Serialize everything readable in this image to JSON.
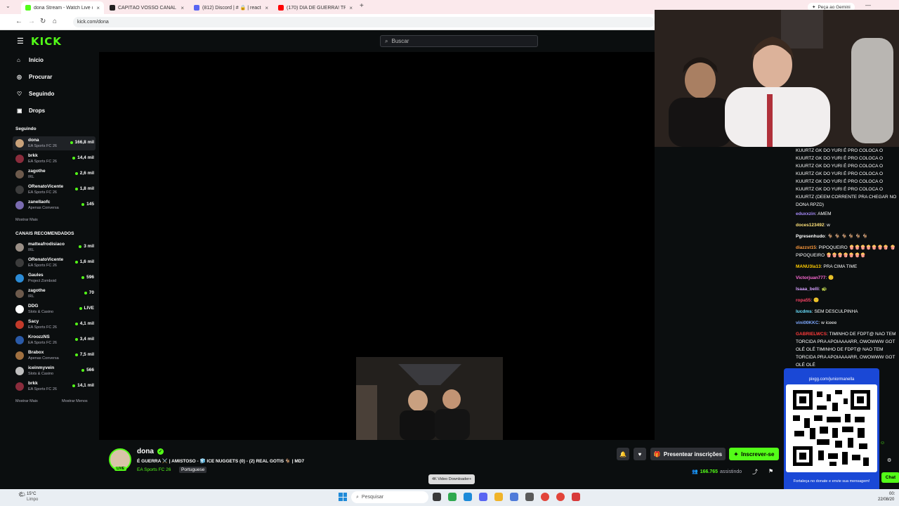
{
  "browser": {
    "tabs": [
      {
        "title": "dona Stream - Watch Live o",
        "color": "#53fc18",
        "active": true
      },
      {
        "title": "CAPITÃO VOSSO CANAL",
        "color": "#222222",
        "active": false
      },
      {
        "title": "(812) Discord | # 🔒 | react-linic",
        "color": "#5865f2",
        "active": false
      },
      {
        "title": "(170) DIA DE GUERRA! TRAR&",
        "color": "#ff0000",
        "active": false
      }
    ],
    "url": "kick.com/dona",
    "gemini": "Peça ao Gemini"
  },
  "header": {
    "logo": "KICK",
    "search_placeholder": "Buscar"
  },
  "sidebar": {
    "nav": [
      {
        "label": "Início",
        "icon": "home-icon"
      },
      {
        "label": "Procurar",
        "icon": "compass-icon"
      },
      {
        "label": "Seguindo",
        "icon": "heart-icon"
      },
      {
        "label": "Drops",
        "icon": "gift-icon"
      }
    ],
    "following_title": "Seguindo",
    "following": [
      {
        "name": "dona",
        "category": "EA Sports FC 26",
        "viewers": "166,8 mil",
        "color": "#c9a27a"
      },
      {
        "name": "brkk",
        "category": "EA Sports FC 26",
        "viewers": "14,4 mil",
        "color": "#8a2c3c"
      },
      {
        "name": "zagothe",
        "category": "IRL",
        "viewers": "2,6 mil",
        "color": "#6d5a4c"
      },
      {
        "name": "ORenatoVicente",
        "category": "EA Sports FC 26",
        "viewers": "1,8 mil",
        "color": "#3c3c3c"
      },
      {
        "name": "zanellaofc",
        "category": "Apenas Conversa",
        "viewers": "145",
        "color": "#7a6bb0"
      }
    ],
    "show_more": "Mostrar Mais",
    "recommended_title": "CANAIS RECOMENDADOS",
    "recommended": [
      {
        "name": "matteafrodisiaco",
        "category": "IRL",
        "viewers": "3 mil",
        "color": "#9a8f86"
      },
      {
        "name": "ORenatoVicente",
        "category": "EA Sports FC 26",
        "viewers": "1,6 mil",
        "color": "#3c3c3c"
      },
      {
        "name": "Gaules",
        "category": "Project Zomboid",
        "viewers": "596",
        "color": "#2b8bd6"
      },
      {
        "name": "zagothe",
        "category": "IRL",
        "viewers": "70",
        "color": "#6d5a4c"
      },
      {
        "name": "DDG",
        "category": "Slots & Casino",
        "viewers": "LIVE",
        "color": "#ffffff"
      },
      {
        "name": "Sacy",
        "category": "EA Sports FC 26",
        "viewers": "4,1 mil",
        "color": "#c23a2a"
      },
      {
        "name": "KroozzNS",
        "category": "EA Sports FC 26",
        "viewers": "3,4 mil",
        "color": "#2a5aa8"
      },
      {
        "name": "Brabox",
        "category": "Apenas Conversa",
        "viewers": "7,5 mil",
        "color": "#a07040"
      },
      {
        "name": "iceinmyvein",
        "category": "Slots & Casino",
        "viewers": "566",
        "color": "#bfbfbf"
      },
      {
        "name": "brkk",
        "category": "EA Sports FC 26",
        "viewers": "14,1 mil",
        "color": "#8a2c3c"
      }
    ],
    "show_less": "Mostrar Menos"
  },
  "stream": {
    "channel": "dona",
    "live_badge": "LIVE",
    "title": "É GUERRA ⚔️ | AMISTOSO - 🧊 ICE NUGGETS (0) - (2) REAL GOTIS 🐐 | MD7",
    "category": "EA Sports FC 26",
    "language": "Portuguese",
    "gift_button": "Presentear inscrições",
    "subscribe_button": "Inscrever-se",
    "viewers": "166.765",
    "viewers_label": "assistindo"
  },
  "chat": {
    "messages": [
      {
        "user": "",
        "user_color": "#ffffff",
        "text": "KUURTZ GK DO YURI É PRO COLOCA O KUURTZ GK DO YURI É PRO COLOCA O KUURTZ GK DO YURI É PRO COLOCA O KUURTZ GK DO YURI É PRO COLOCA O KUURTZ GK DO YURI É PRO COLOCA O KUURTZ GK DO YURI É PRO COLOCA O KUURTZ (DEEM CORRENTE PRA CHEGAR NO DONA RPZD)"
      },
      {
        "user": "eduxxzin",
        "user_color": "#a88bfa",
        "text": "AMEM"
      },
      {
        "user": "doces123492",
        "user_color": "#ffe27a",
        "text": "w"
      },
      {
        "user": "Pgresenhudo",
        "user_color": "#ffffff",
        "text": "🐐 🐐 🐐 🐐 🐐 🐐"
      },
      {
        "user": "diazzst15",
        "user_color": "#ff9a3c",
        "text": "PIPOQUEIRO 🍿🍿🍿🍿🍿🍿🍿 🍿 PIPOQUEIRO 🍿🍿🍿🍿🍿🍿🍿"
      },
      {
        "user": "MANU3la13",
        "user_color": "#ffcc00",
        "text": "PRA CIMA TIME"
      },
      {
        "user": "Victorjuan777",
        "user_color": "#ff6ad5",
        "text": "🙂"
      },
      {
        "user": "Isaaa_belli",
        "user_color": "#d6a0ff",
        "text": "🐢"
      },
      {
        "user": "ropa55",
        "user_color": "#ff4466",
        "text": "🙂"
      },
      {
        "user": "lucdms",
        "user_color": "#6ae0ff",
        "text": "SEM DESCULPINHA"
      },
      {
        "user": "vini00KKC",
        "user_color": "#7fa9ff",
        "text": "w iceee"
      },
      {
        "user": "GABRIELWCS",
        "user_color": "#ff3b3b",
        "text": "TIMINHO DE FDPT@ NAO TEM TORCIDA PRA APOIAAAARR, OWOWWW GOT OLÉ OLÉ TIMINHO DE FDPT@ NAO TEM TORCIDA PRA APOIAAAARR, OWOWWW GOT OLÉ OLÉ"
      }
    ],
    "chat_button": "Chat"
  },
  "qr_overlay": {
    "url": "pixgg.com/juniormanella",
    "caption": "Fortaleça no donate e envie sua mensagem!"
  },
  "video_downloader": "4K Video Downloader+",
  "taskbar": {
    "weather_temp": "15°C",
    "weather_desc": "Limpo",
    "search_placeholder": "Pesquisar",
    "time": "00:",
    "date": "22/08/20"
  }
}
